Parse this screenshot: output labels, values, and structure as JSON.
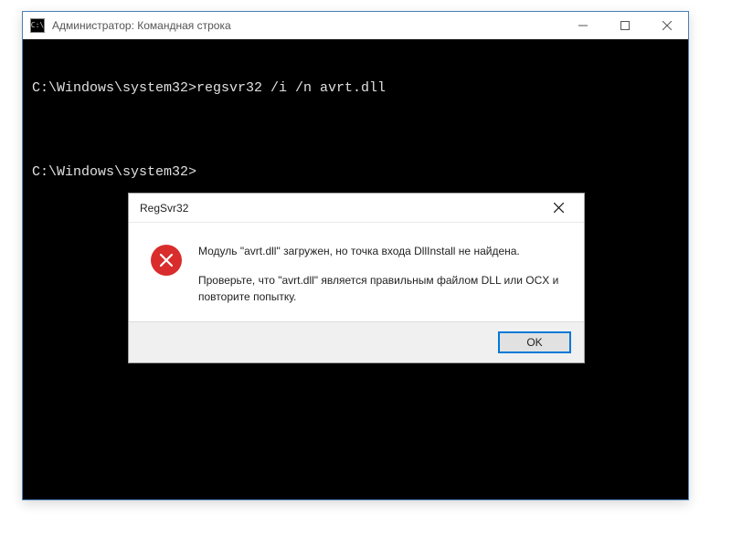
{
  "cmd": {
    "title": "Администратор: Командная строка",
    "lines": [
      "C:\\Windows\\system32>regsvr32 /i /n avrt.dll",
      "",
      "C:\\Windows\\system32>"
    ]
  },
  "dialog": {
    "title": "RegSvr32",
    "msg1": "Модуль \"avrt.dll\" загружен, но точка входа DllInstall не найдена.",
    "msg2": "Проверьте, что \"avrt.dll\" является правильным файлом DLL или OCX и повторите попытку.",
    "ok": "OK"
  }
}
